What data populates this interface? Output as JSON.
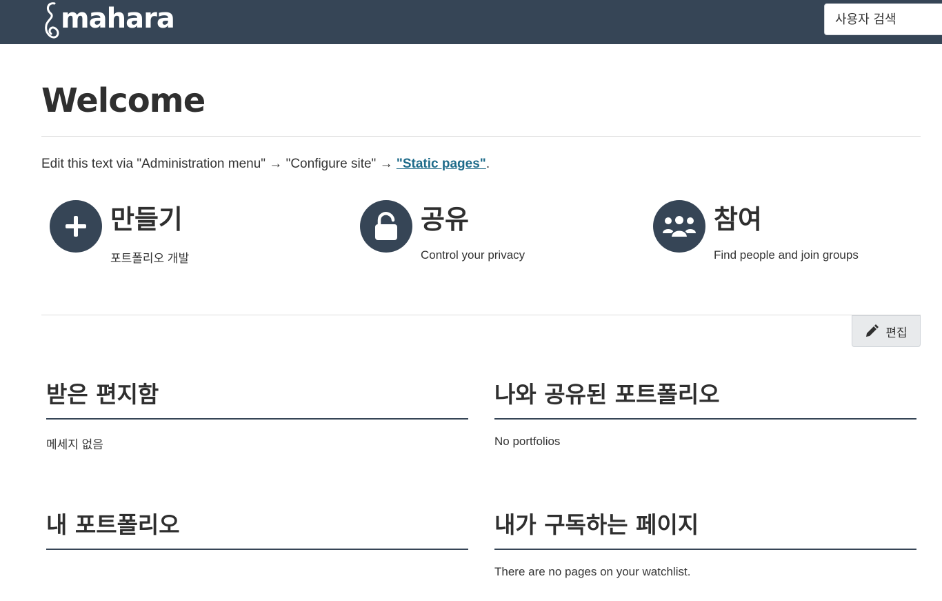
{
  "header": {
    "logo_text": "mahara",
    "search_placeholder": "사용자 검색"
  },
  "page": {
    "title": "Welcome",
    "intro_prefix": "Edit this text via \"Administration menu\" → \"Configure site\" → ",
    "intro_link": "\"Static pages\"",
    "intro_suffix": "."
  },
  "features": [
    {
      "title": "만들기",
      "description": "포트폴리오 개발",
      "icon": "plus-icon"
    },
    {
      "title": "공유",
      "description": "Control your privacy",
      "icon": "unlock-icon"
    },
    {
      "title": "참여",
      "description": "Find people and join groups",
      "icon": "users-icon"
    }
  ],
  "toolbar": {
    "edit_label": "편집",
    "edit_icon": "pencil-icon"
  },
  "blocks": [
    {
      "title": "받은 편지함",
      "body": "메세지 없음"
    },
    {
      "title": "나와 공유된 포트폴리오",
      "body": "No portfolios"
    },
    {
      "title": "내 포트폴리오",
      "body": ""
    },
    {
      "title": "내가 구독하는 페이지",
      "body": "There are no pages on your watchlist."
    }
  ],
  "colors": {
    "header_bg": "#364556",
    "link": "#1e6b8a"
  }
}
